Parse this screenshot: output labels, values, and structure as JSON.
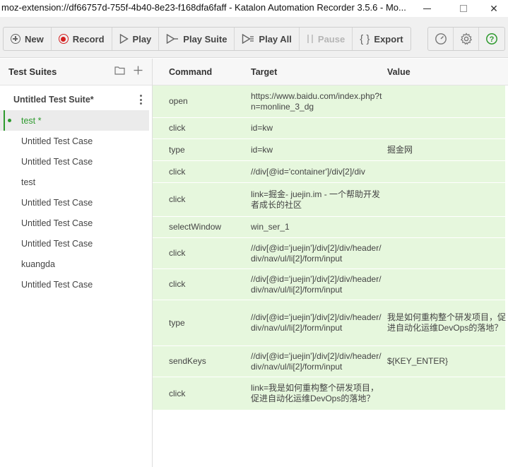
{
  "window": {
    "title": "moz-extension://df66757d-755f-4b40-8e23-f168dfa6faff - Katalon Automation Recorder 3.5.6 - Mo..."
  },
  "toolbar": {
    "new_label": "New",
    "record_label": "Record",
    "play_label": "Play",
    "play_suite_label": "Play Suite",
    "play_all_label": "Play All",
    "pause_label": "Pause",
    "export_label": "Export",
    "record_color": "#d42020",
    "help_color": "#2e9a2e"
  },
  "sidebar": {
    "header": "Test Suites",
    "suite_name": "Untitled Test Suite*",
    "cases": [
      {
        "name": "test *",
        "active": true
      },
      {
        "name": "Untitled Test Case"
      },
      {
        "name": "Untitled Test Case"
      },
      {
        "name": "test"
      },
      {
        "name": "Untitled Test Case"
      },
      {
        "name": "Untitled Test Case"
      },
      {
        "name": "Untitled Test Case"
      },
      {
        "name": "kuangda"
      },
      {
        "name": "Untitled Test Case"
      }
    ]
  },
  "table": {
    "headers": {
      "command": "Command",
      "target": "Target",
      "value": "Value"
    },
    "row_color": "#e6f7dd",
    "rows": [
      {
        "command": "open",
        "target": "https://www.baidu.com/index.php?tn=monline_3_dg",
        "value": ""
      },
      {
        "command": "click",
        "target": "id=kw",
        "value": ""
      },
      {
        "command": "type",
        "target": "id=kw",
        "value": "掘金网"
      },
      {
        "command": "click",
        "target": "//div[@id='container']/div[2]/div",
        "value": ""
      },
      {
        "command": "click",
        "target": "link=掘金- juejin.im - 一个帮助开发者成长的社区",
        "value": ""
      },
      {
        "command": "selectWindow",
        "target": "win_ser_1",
        "value": ""
      },
      {
        "command": "click",
        "target": "//div[@id='juejin']/div[2]/div/header/div/nav/ul/li[2]/form/input",
        "value": ""
      },
      {
        "command": "click",
        "target": "//div[@id='juejin']/div[2]/div/header/div/nav/ul/li[2]/form/input",
        "value": ""
      },
      {
        "command": "type",
        "target": "//div[@id='juejin']/div[2]/div/header/div/nav/ul/li[2]/form/input",
        "value": "我是如何重构整个研发项目，促进自动化运维DevOps的落地？"
      },
      {
        "command": "sendKeys",
        "target": "//div[@id='juejin']/div[2]/div/header/div/nav/ul/li[2]/form/input",
        "value": "${KEY_ENTER}"
      },
      {
        "command": "click",
        "target": "link=我是如何重构整个研发项目，促进自动化运维DevOps的落地？",
        "value": ""
      }
    ]
  }
}
